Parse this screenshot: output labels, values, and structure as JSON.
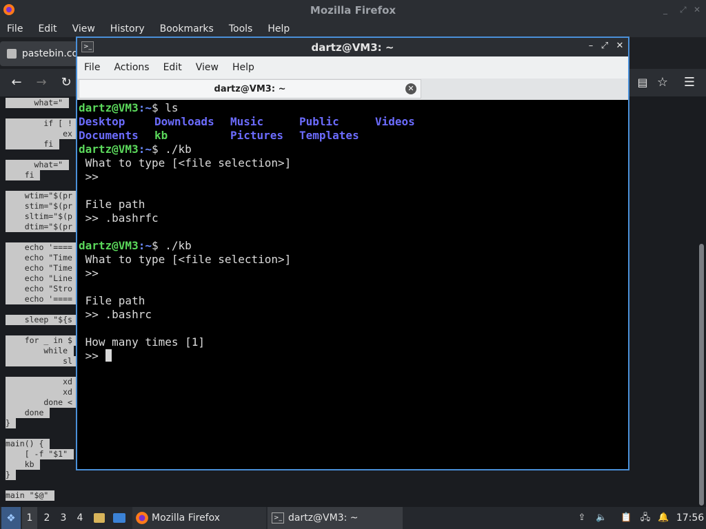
{
  "firefox": {
    "title": "Mozilla Firefox",
    "menu": [
      "File",
      "Edit",
      "View",
      "History",
      "Bookmarks",
      "Tools",
      "Help"
    ],
    "tab_label": "pastebin.co"
  },
  "page": {
    "code_lines": [
      "      what=\"",
      "",
      "        if [ !",
      "            ex",
      "        fi",
      "",
      "      what=\"",
      "    fi",
      "",
      "    wtim=\"$(pr",
      "    stim=\"$(pr",
      "    sltim=\"$(p",
      "    dtim=\"$(pr",
      "",
      "    echo '====",
      "    echo \"Time",
      "    echo \"Time",
      "    echo \"Line",
      "    echo \"Stro",
      "    echo '====",
      "",
      "    sleep \"${s",
      "",
      "    for _ in $",
      "        while",
      "            sl",
      "",
      "            xd",
      "            xd",
      "        done <",
      "    done",
      "}",
      "",
      "main() {",
      "    [ -f \"$1\"",
      "    kb",
      "}",
      "",
      "main \"$@\""
    ]
  },
  "terminal": {
    "title": "dartz@VM3: ~",
    "menu": [
      "File",
      "Actions",
      "Edit",
      "View",
      "Help"
    ],
    "tab_label": "dartz@VM3: ~",
    "prompt_user": "dartz@VM3",
    "prompt_path": ":~",
    "prompt_sign": "$ ",
    "cmd_ls": "ls",
    "ls_row1": [
      "Desktop",
      "Downloads",
      "Music",
      "Public",
      "Videos"
    ],
    "ls_row2": [
      "Documents",
      "kb",
      "Pictures",
      "Templates"
    ],
    "cmd_kb": "./kb",
    "what_to_type": " What to type [<file selection>]",
    "prompt_arrow": " >>",
    "file_path": " File path",
    "answer1": " >> .bashrfc",
    "answer2": " >> .bashrc",
    "how_many": " How many times [1]",
    "last_prompt": " >> "
  },
  "taskbar": {
    "workspaces": [
      "1",
      "2",
      "3",
      "4"
    ],
    "firefox_label": "Mozilla Firefox",
    "terminal_label": "dartz@VM3: ~",
    "clock": "17:56"
  }
}
